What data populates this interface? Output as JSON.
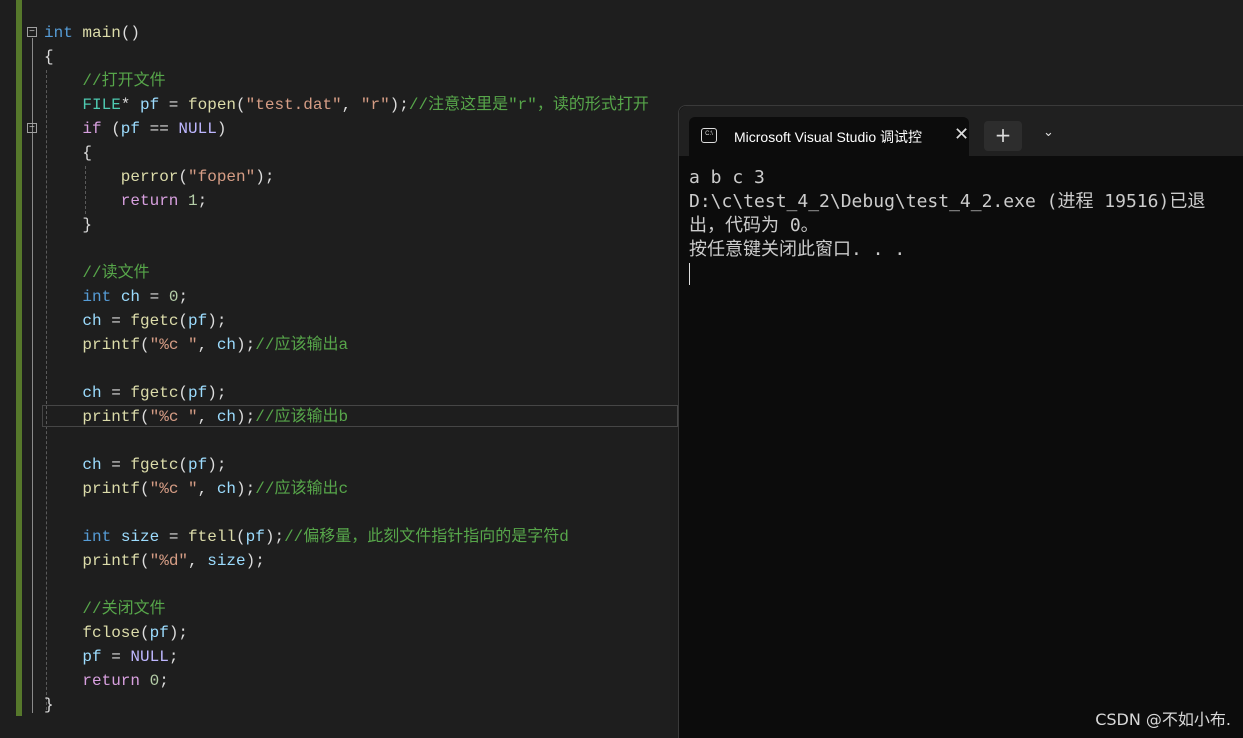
{
  "editor": {
    "lines": [
      {
        "indent": 0,
        "tokens": [
          [
            "int",
            "k"
          ],
          [
            " ",
            "p"
          ],
          [
            "main",
            "f"
          ],
          [
            "()",
            "p"
          ]
        ]
      },
      {
        "indent": 0,
        "tokens": [
          [
            "{",
            "p"
          ]
        ]
      },
      {
        "indent": 1,
        "tokens": [
          [
            "//打开文件",
            "m"
          ]
        ]
      },
      {
        "indent": 1,
        "tokens": [
          [
            "FILE",
            "t"
          ],
          [
            "* ",
            "p"
          ],
          [
            "pf",
            "v"
          ],
          [
            " = ",
            "p"
          ],
          [
            "fopen",
            "f"
          ],
          [
            "(",
            "p"
          ],
          [
            "\"test.dat\"",
            "s"
          ],
          [
            ", ",
            "p"
          ],
          [
            "\"r\"",
            "s"
          ],
          [
            ");",
            "p"
          ],
          [
            "//注意这里是\"r\"，读的形式打开",
            "m"
          ]
        ]
      },
      {
        "indent": 1,
        "tokens": [
          [
            "if",
            "c"
          ],
          [
            " (",
            "p"
          ],
          [
            "pf",
            "v"
          ],
          [
            " == ",
            "p"
          ],
          [
            "NULL",
            "u"
          ],
          [
            ")",
            "p"
          ]
        ]
      },
      {
        "indent": 1,
        "tokens": [
          [
            "{",
            "p"
          ]
        ]
      },
      {
        "indent": 2,
        "tokens": [
          [
            "perror",
            "f"
          ],
          [
            "(",
            "p"
          ],
          [
            "\"fopen\"",
            "s"
          ],
          [
            ");",
            "p"
          ]
        ]
      },
      {
        "indent": 2,
        "tokens": [
          [
            "return",
            "c"
          ],
          [
            " ",
            "p"
          ],
          [
            "1",
            "n"
          ],
          [
            ";",
            "p"
          ]
        ]
      },
      {
        "indent": 1,
        "tokens": [
          [
            "}",
            "p"
          ]
        ]
      },
      {
        "indent": 0,
        "tokens": []
      },
      {
        "indent": 1,
        "tokens": [
          [
            "//读文件",
            "m"
          ]
        ]
      },
      {
        "indent": 1,
        "tokens": [
          [
            "int",
            "k"
          ],
          [
            " ",
            "p"
          ],
          [
            "ch",
            "v"
          ],
          [
            " = ",
            "p"
          ],
          [
            "0",
            "n"
          ],
          [
            ";",
            "p"
          ]
        ]
      },
      {
        "indent": 1,
        "tokens": [
          [
            "ch",
            "v"
          ],
          [
            " = ",
            "p"
          ],
          [
            "fgetc",
            "f"
          ],
          [
            "(",
            "p"
          ],
          [
            "pf",
            "v"
          ],
          [
            ");",
            "p"
          ]
        ]
      },
      {
        "indent": 1,
        "tokens": [
          [
            "printf",
            "f"
          ],
          [
            "(",
            "p"
          ],
          [
            "\"%c \"",
            "s"
          ],
          [
            ", ",
            "p"
          ],
          [
            "ch",
            "v"
          ],
          [
            ");",
            "p"
          ],
          [
            "//应该输出a",
            "m"
          ]
        ]
      },
      {
        "indent": 0,
        "tokens": []
      },
      {
        "indent": 1,
        "tokens": [
          [
            "ch",
            "v"
          ],
          [
            " = ",
            "p"
          ],
          [
            "fgetc",
            "f"
          ],
          [
            "(",
            "p"
          ],
          [
            "pf",
            "v"
          ],
          [
            ");",
            "p"
          ]
        ]
      },
      {
        "indent": 1,
        "tokens": [
          [
            "printf",
            "f"
          ],
          [
            "(",
            "p"
          ],
          [
            "\"%c \"",
            "s"
          ],
          [
            ", ",
            "p"
          ],
          [
            "ch",
            "v"
          ],
          [
            ");",
            "p"
          ],
          [
            "//应该输出b",
            "m"
          ]
        ]
      },
      {
        "indent": 0,
        "tokens": []
      },
      {
        "indent": 1,
        "tokens": [
          [
            "ch",
            "v"
          ],
          [
            " = ",
            "p"
          ],
          [
            "fgetc",
            "f"
          ],
          [
            "(",
            "p"
          ],
          [
            "pf",
            "v"
          ],
          [
            ");",
            "p"
          ]
        ]
      },
      {
        "indent": 1,
        "tokens": [
          [
            "printf",
            "f"
          ],
          [
            "(",
            "p"
          ],
          [
            "\"%c \"",
            "s"
          ],
          [
            ", ",
            "p"
          ],
          [
            "ch",
            "v"
          ],
          [
            ");",
            "p"
          ],
          [
            "//应该输出c",
            "m"
          ]
        ]
      },
      {
        "indent": 0,
        "tokens": []
      },
      {
        "indent": 1,
        "tokens": [
          [
            "int",
            "k"
          ],
          [
            " ",
            "p"
          ],
          [
            "size",
            "v"
          ],
          [
            " = ",
            "p"
          ],
          [
            "ftell",
            "f"
          ],
          [
            "(",
            "p"
          ],
          [
            "pf",
            "v"
          ],
          [
            ");",
            "p"
          ],
          [
            "//偏移量，此刻文件指针指向的是字符d",
            "m"
          ]
        ]
      },
      {
        "indent": 1,
        "tokens": [
          [
            "printf",
            "f"
          ],
          [
            "(",
            "p"
          ],
          [
            "\"%d\"",
            "s"
          ],
          [
            ", ",
            "p"
          ],
          [
            "size",
            "v"
          ],
          [
            ");",
            "p"
          ]
        ]
      },
      {
        "indent": 0,
        "tokens": []
      },
      {
        "indent": 1,
        "tokens": [
          [
            "//关闭文件",
            "m"
          ]
        ]
      },
      {
        "indent": 1,
        "tokens": [
          [
            "fclose",
            "f"
          ],
          [
            "(",
            "p"
          ],
          [
            "pf",
            "v"
          ],
          [
            ");",
            "p"
          ]
        ]
      },
      {
        "indent": 1,
        "tokens": [
          [
            "pf",
            "v"
          ],
          [
            " = ",
            "p"
          ],
          [
            "NULL",
            "u"
          ],
          [
            ";",
            "p"
          ]
        ]
      },
      {
        "indent": 1,
        "tokens": [
          [
            "return",
            "c"
          ],
          [
            " ",
            "p"
          ],
          [
            "0",
            "n"
          ],
          [
            ";",
            "p"
          ]
        ]
      },
      {
        "indent": 0,
        "tokens": [
          [
            "}",
            "p"
          ]
        ]
      }
    ],
    "current_line": 17,
    "fold_icon": "minus-box-icon"
  },
  "terminal": {
    "tab_title": "Microsoft Visual Studio 调试控",
    "tab_icon": "console-icon",
    "tab_icon_text": "C:\\",
    "close_glyph": "✕",
    "new_tab_glyph": "+",
    "dropdown_glyph": "⌄",
    "output": [
      "a b c 3",
      "D:\\c\\test_4_2\\Debug\\test_4_2.exe (进程 19516)已退出，代码为 0。",
      "按任意键关闭此窗口. . ."
    ]
  },
  "watermark": "CSDN @不如小布."
}
